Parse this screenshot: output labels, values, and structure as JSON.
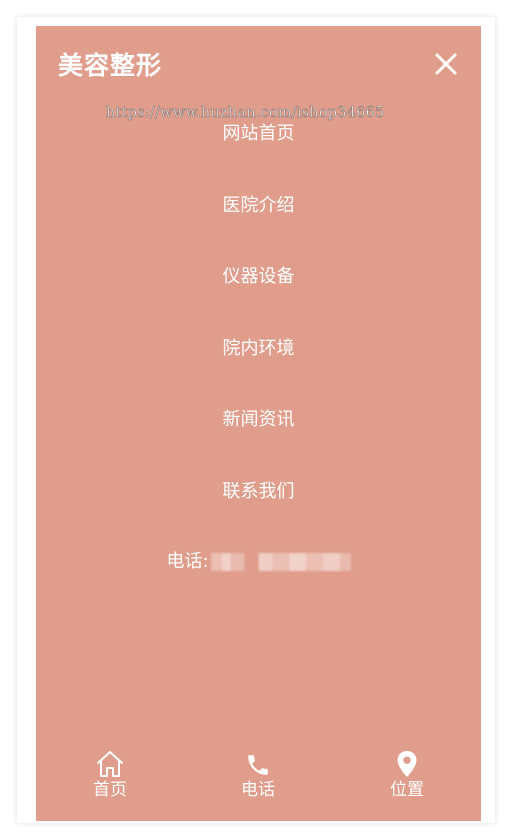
{
  "header": {
    "logo_text": "美容整形"
  },
  "watermark": "https://www.huzhan.com/ishop34665",
  "menu": {
    "items": [
      {
        "label": "网站首页"
      },
      {
        "label": "医院介绍"
      },
      {
        "label": "仪器设备"
      },
      {
        "label": "院内环境"
      },
      {
        "label": "新闻资讯"
      },
      {
        "label": "联系我们"
      }
    ]
  },
  "contact": {
    "phone_label": "电话:"
  },
  "bottom_nav": {
    "items": [
      {
        "label": "首页",
        "icon": "home-icon"
      },
      {
        "label": "电话",
        "icon": "phone-icon"
      },
      {
        "label": "位置",
        "icon": "location-pin-icon"
      }
    ]
  },
  "colors": {
    "panel_background": "#e09d8b",
    "text": "#ffffff"
  }
}
